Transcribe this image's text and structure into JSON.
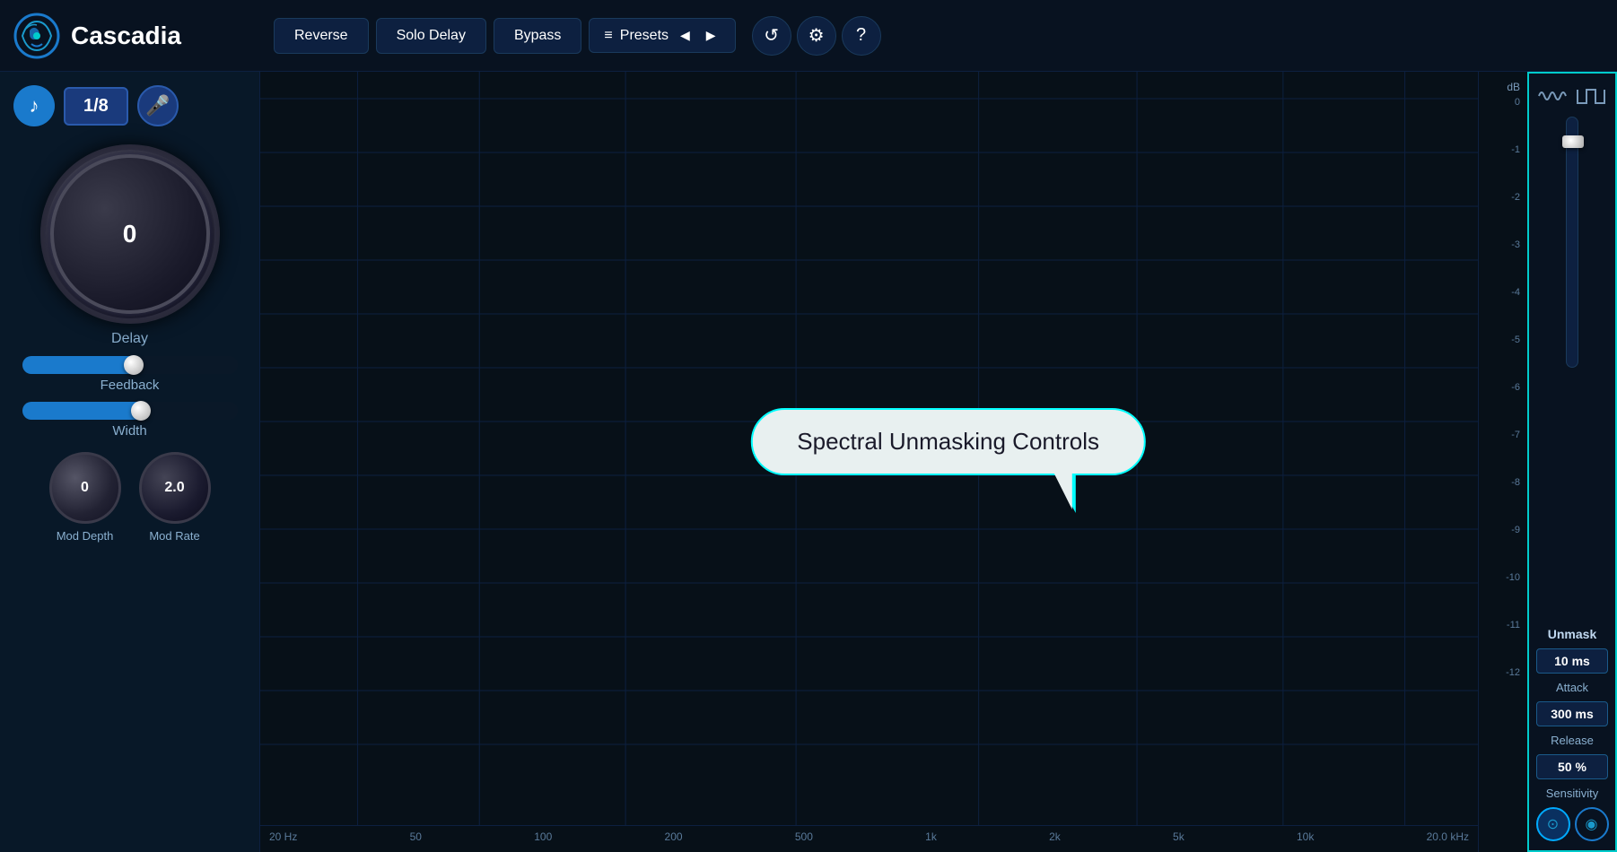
{
  "app": {
    "name": "Cascadia"
  },
  "header": {
    "reverse_label": "Reverse",
    "solo_delay_label": "Solo Delay",
    "bypass_label": "Bypass",
    "presets_label": "Presets",
    "icons": {
      "reset": "↺",
      "settings": "⚙",
      "help": "?"
    }
  },
  "left_sidebar": {
    "fraction": "1/8",
    "delay_knob": {
      "value": "0",
      "label": "Delay"
    },
    "feedback_slider": {
      "label": "Feedback"
    },
    "width_slider": {
      "label": "Width"
    },
    "mod_depth_knob": {
      "value": "0",
      "label": "Mod Depth"
    },
    "mod_rate_knob": {
      "value": "2.0",
      "label": "Mod Rate"
    }
  },
  "visualizer": {
    "speech_bubble_text": "Spectral Unmasking Controls",
    "freq_labels": [
      "20 Hz",
      "50",
      "100",
      "200",
      "500",
      "1k",
      "2k",
      "5k",
      "10k",
      "20.0 kHz"
    ],
    "db_labels": [
      "dB",
      "0",
      "-1",
      "-2",
      "-3",
      "-4",
      "-5",
      "-6",
      "-7",
      "-8",
      "-9",
      "-10",
      "-11",
      "-12"
    ]
  },
  "right_sidebar": {
    "unmask_label": "Unmask",
    "attack_value": "10 ms",
    "attack_label": "Attack",
    "release_value": "300 ms",
    "release_label": "Release",
    "sensitivity_value": "50 %",
    "sensitivity_label": "Sensitivity",
    "bottom_icons": {
      "target": "⊙",
      "ear": "◉"
    }
  }
}
